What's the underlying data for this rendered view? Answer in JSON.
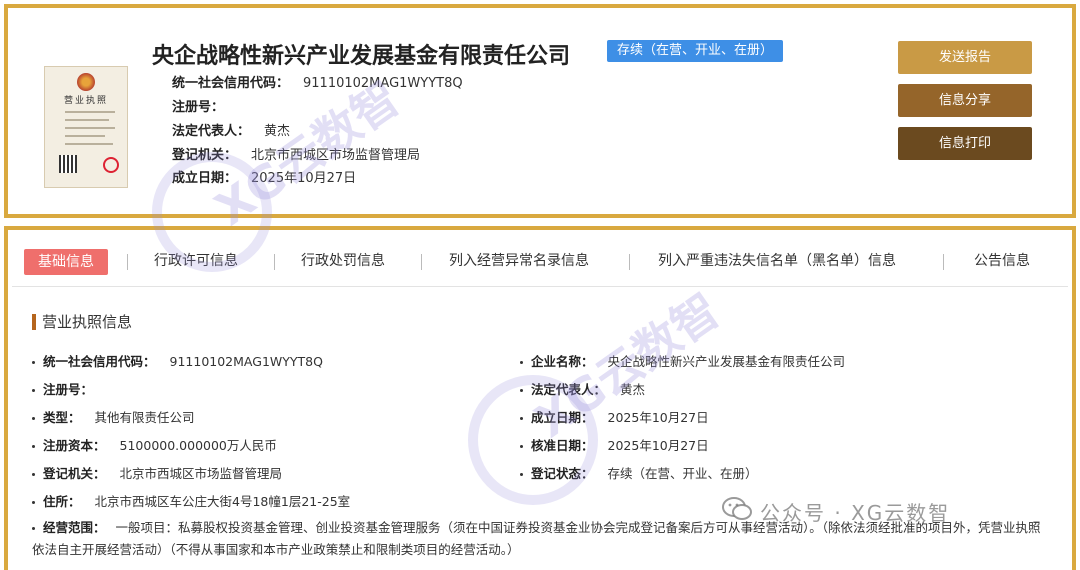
{
  "header": {
    "company_name": "央企战略性新兴产业发展基金有限责任公司",
    "status_tag": "存续（在营、开业、在册）",
    "license_title": "营业执照",
    "rows": [
      {
        "label": "统一社会信用代码：",
        "value": "91110102MAG1WYYT8Q"
      },
      {
        "label": "注册号：",
        "value": ""
      },
      {
        "label": "法定代表人：",
        "value": "黄杰"
      },
      {
        "label": "登记机关：",
        "value": "北京市西城区市场监督管理局"
      },
      {
        "label": "成立日期：",
        "value": "2025年10月27日"
      }
    ],
    "buttons": {
      "send_report": "发送报告",
      "share_info": "信息分享",
      "print_info": "信息打印"
    }
  },
  "tabs": [
    {
      "label": "基础信息",
      "active": true
    },
    {
      "label": "行政许可信息",
      "active": false
    },
    {
      "label": "行政处罚信息",
      "active": false
    },
    {
      "label": "列入经营异常名录信息",
      "active": false
    },
    {
      "label": "列入严重违法失信名单（黑名单）信息",
      "active": false
    },
    {
      "label": "公告信息",
      "active": false
    }
  ],
  "section": {
    "title": "营业执照信息",
    "left": [
      {
        "label": "统一社会信用代码：",
        "value": "91110102MAG1WYYT8Q"
      },
      {
        "label": "注册号：",
        "value": ""
      },
      {
        "label": "类型：",
        "value": "其他有限责任公司"
      },
      {
        "label": "注册资本：",
        "value": "5100000.000000万人民币"
      },
      {
        "label": "登记机关：",
        "value": "北京市西城区市场监督管理局"
      },
      {
        "label": "住所：",
        "value": "北京市西城区车公庄大街4号18幢1层21-25室"
      }
    ],
    "right": [
      {
        "label": "企业名称：",
        "value": "央企战略性新兴产业发展基金有限责任公司"
      },
      {
        "label": "法定代表人：",
        "value": "黄杰"
      },
      {
        "label": "成立日期：",
        "value": "2025年10月27日"
      },
      {
        "label": "核准日期：",
        "value": "2025年10月27日"
      },
      {
        "label": "登记状态：",
        "value": "存续（在营、开业、在册）"
      }
    ],
    "scope": {
      "label": "经营范围：",
      "value": "一般项目：私募股权投资基金管理、创业投资基金管理服务（须在中国证券投资基金业协会完成登记备案后方可从事经营活动）。（除依法须经批准的项目外，凭营业执照依法自主开展经营活动）（不得从事国家和本市产业政策禁止和限制类项目的经营活动。）"
    }
  },
  "watermark": {
    "text": "XG云数智",
    "wechat": "公众号 · XG云数智"
  },
  "colors": {
    "frame": "#d9a93f",
    "status": "#3e8fe6",
    "active_tab": "#ef6f6c",
    "btn1": "#c99a45",
    "btn2": "#95652a",
    "btn3": "#6b4a1f"
  }
}
